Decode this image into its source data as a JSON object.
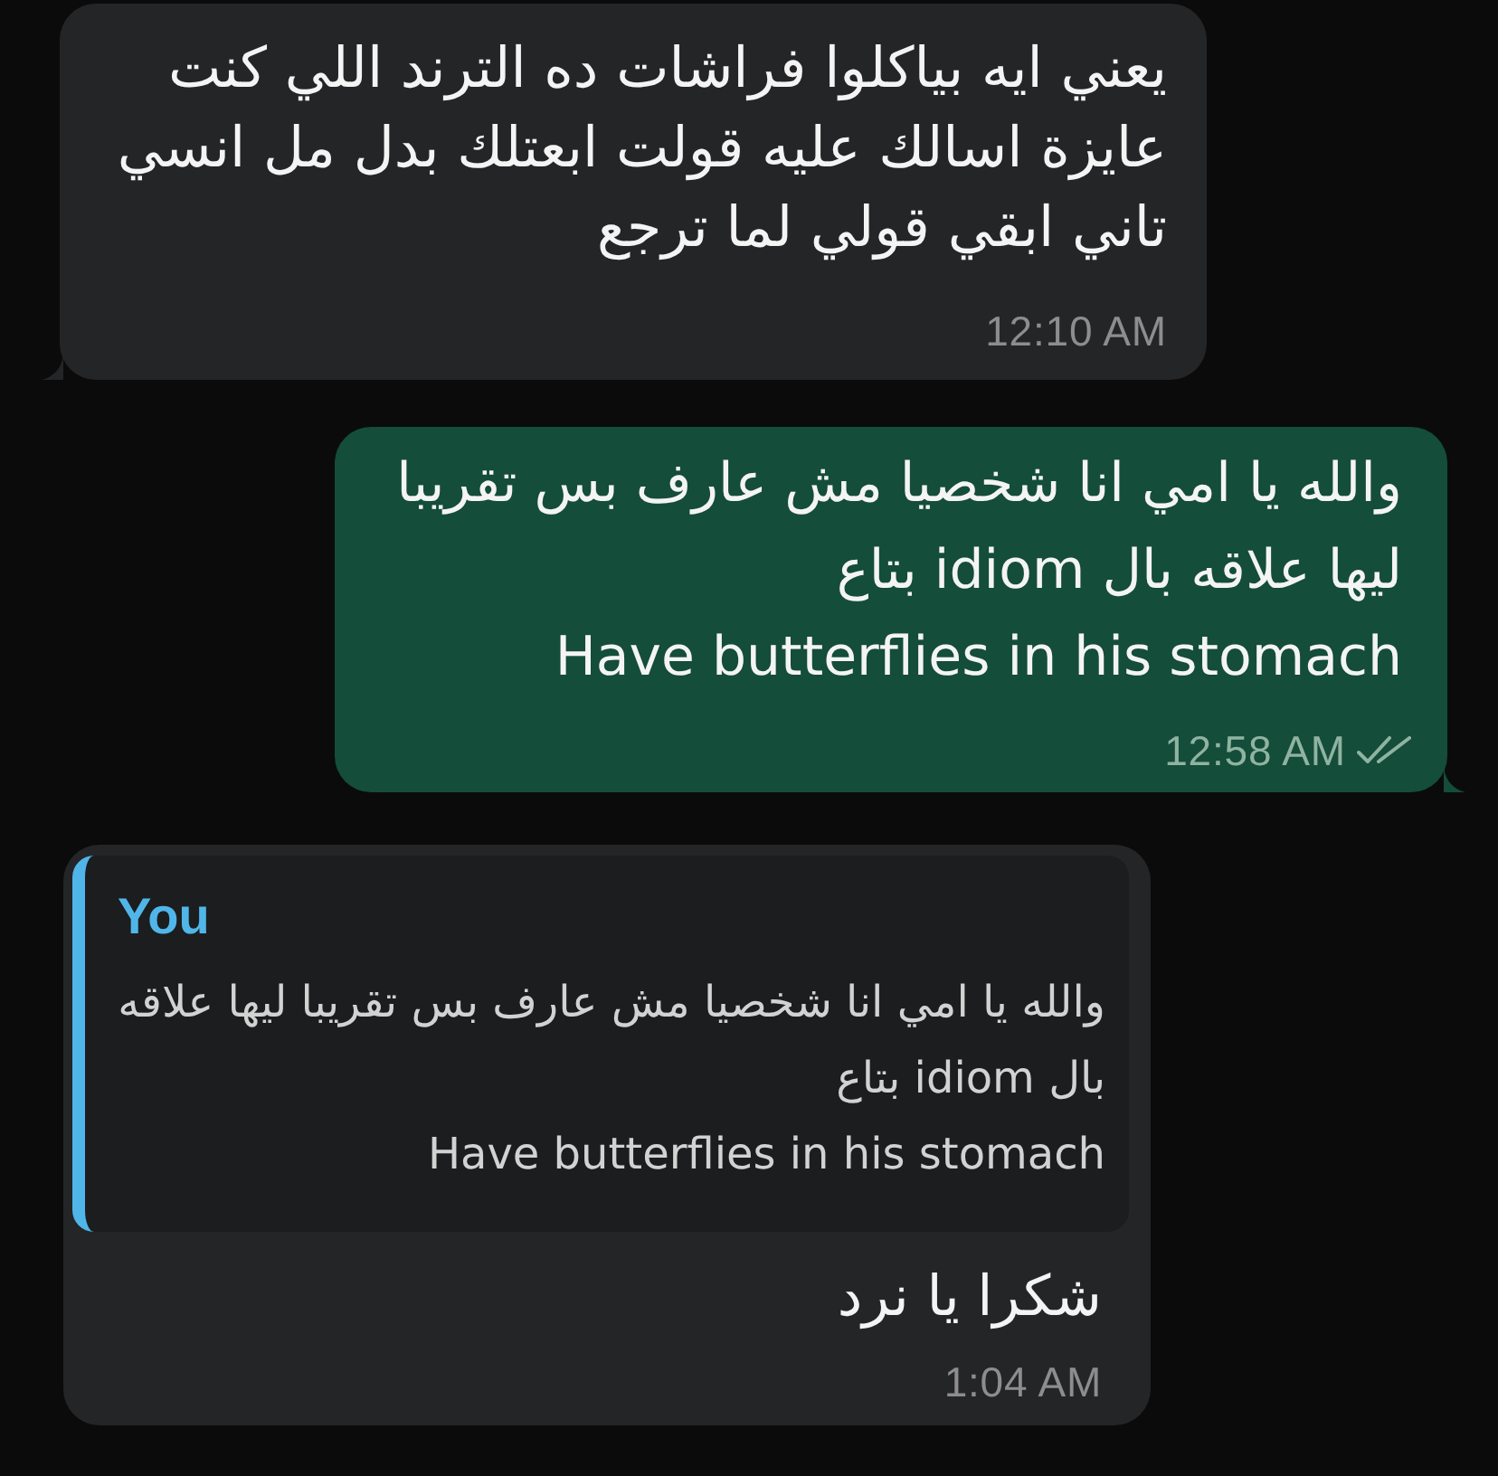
{
  "messages": [
    {
      "kind": "incoming",
      "tail": true,
      "text": "يعني ايه بياكلوا فراشات ده الترند اللي كنت عايزة اسالك عليه قولت ابعتلك بدل مل انسي تاني ابقي قولي لما ترجع",
      "time": "12:10 AM"
    },
    {
      "kind": "outgoing",
      "tail": true,
      "text": "والله يا امي انا شخصيا مش عارف بس تقريبا ليها علاقه بال idiom بتاع\nHave butterflies in his stomach",
      "time": "12:58 AM",
      "delivered": true,
      "read": false
    },
    {
      "kind": "incoming",
      "tail": false,
      "reply_to": {
        "sender": "You",
        "text": "والله يا امي انا شخصيا مش عارف بس تقريبا ليها علاقه بال idiom بتاع\nHave butterflies in his stomach"
      },
      "text": "شكرا يا نرد",
      "time": "1:04 AM"
    }
  ]
}
